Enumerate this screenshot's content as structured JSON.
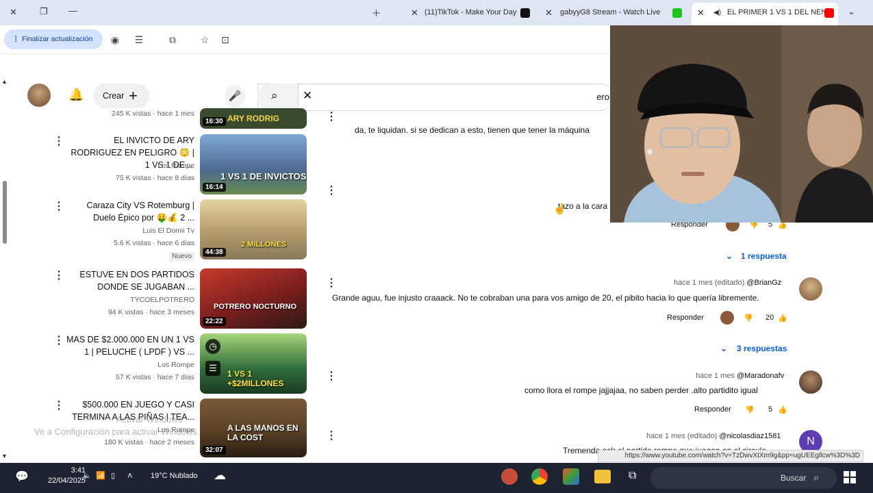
{
  "browser": {
    "tabs": [
      {
        "title": "EL PRIMER 1 VS 1 DEL NEN",
        "active": true
      },
      {
        "title": "gabyyG8 Stream - Watch Live",
        "active": false
      },
      {
        "title": "(11)TikTok - Make Your Day",
        "active": false
      }
    ],
    "update_label": "Finalizar actualización",
    "status_url": "https://www.youtube.com/watch?v=TzDwvXtXm9g&pp=ugUEEgllcw%3D%3D"
  },
  "youtube": {
    "create_label": "Crear",
    "search_value": "ero"
  },
  "videos": [
    {
      "title": "",
      "channel": "",
      "meta": "245 K vistas · hace 1 mes",
      "duration": "16:30",
      "thumb_text": "ARY RODRIG",
      "thumb_color": "#3a4a2e"
    },
    {
      "title": "EL INVICTO DE ARY RODRIGUEZ EN PELIGRO 😳 | 1 VS 1 DE ...",
      "channel": "Los Rompe",
      "meta": "75 K vistas · hace 8 días",
      "duration": "16:14",
      "thumb_text": "1 VS 1 DE INVICTOS",
      "thumb_color": "#4c6a8f"
    },
    {
      "title": "Caraza City VS Rotemburg | Duelo Épico por 🤑💰 2 ...",
      "channel": "Luis El Domii Tv",
      "meta": "5.6 K vistas · hace 6 días",
      "badge": "Nuevo",
      "duration": "44:38",
      "thumb_text": "2 MILLONES",
      "thumb_color": "#b8a070"
    },
    {
      "title": "ESTUVE EN DOS PARTIDOS DONDE SE JUGABAN ...",
      "channel": "TYCOELPOTRERO",
      "meta": "94 K vistas · hace 3 meses",
      "duration": "22:22",
      "thumb_text": "POTRERO NOCTURNO",
      "thumb_color": "#7a1e1e"
    },
    {
      "title": "MAS DE $2.000.000 EN UN 1 VS 1 | PELUCHE ( LPDF ) VS ...",
      "channel": "Los Rompe",
      "meta": "57 K vistas · hace 7 días",
      "duration": "",
      "thumb_text": "1 VS 1 +$2MILLONES",
      "thumb_color": "#2f6b3a"
    },
    {
      "title": "$500.000 EN JUEGO Y CASI TERMINA A LAS PIÑAS | TEA...",
      "channel": "Los Rompe",
      "meta": "180 K vistas · hace 2 meses",
      "duration": "32:07",
      "thumb_text": "A LAS MANOS EN LA COST",
      "thumb_color": "#5a4226"
    }
  ],
  "comments": {
    "partial_top": "da, te liquidan. si se dedican a esto, tienen que tener la máquina",
    "partial_mid": "tazo a la cara",
    "first_actions": {
      "likes": "5",
      "reply": "Responder"
    },
    "first_replies": "1 respuesta",
    "items": [
      {
        "author": "@BrianGz",
        "ago": "hace 1 mes (editado)",
        "text": "Grande aguu, fue injusto craaack. No te cobraban una para vos amigo de 20, el pibito hacia lo que quería libremente.",
        "likes": "20",
        "reply": "Responder",
        "replies": "3 respuestas"
      },
      {
        "author": "@Maradonafv",
        "ago": "hace 1 mes",
        "text": "como llora el rompe jajjajaa,  no saben perder .alto partidito  igual",
        "likes": "5",
        "reply": "Responder"
      },
      {
        "author": "@nicolasdiaz1581",
        "ago": "hace 1 mes (editado)",
        "text": "Tremenda aclr el partido rompe que juegan en el circulo",
        "avatar_letter": "N"
      }
    ]
  },
  "watermark": {
    "line1": "Activar Windows",
    "line2": "Ve a Configuración para activar Windows."
  },
  "taskbar": {
    "search_label": "Buscar",
    "weather": "19°C  Nublado",
    "time": "3:41",
    "date": "22/04/2025"
  },
  "colors": {
    "accent": "#065fd4",
    "tab_strip": "#dfe6f3",
    "taskbar": "#1d2330"
  }
}
